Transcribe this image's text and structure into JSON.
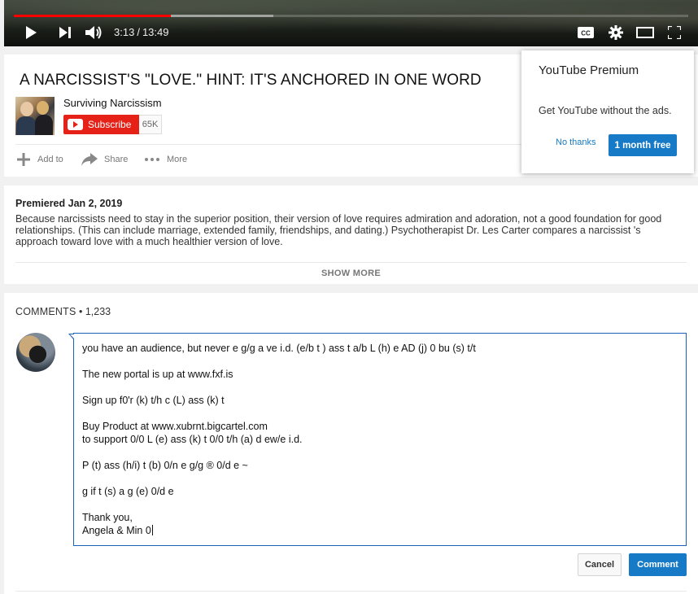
{
  "player": {
    "current_time": "3:13",
    "separator": "/",
    "duration": "13:49",
    "played_fraction": 0.233,
    "buffered_fraction": 0.385,
    "progress_color": "#ff0000"
  },
  "video": {
    "title": "A NARCISSIST'S \"LOVE.\" HINT: IT'S ANCHORED IN ONE WORD",
    "channel_name": "Surviving Narcissism",
    "subscribe_label": "Subscribe",
    "subscriber_count": "65K",
    "actions": [
      {
        "label": "Add to",
        "icon": "plus-icon"
      },
      {
        "label": "Share",
        "icon": "share-arrow-icon"
      },
      {
        "label": "More",
        "icon": "more-dots-icon"
      }
    ]
  },
  "premium_popup": {
    "title": "YouTube Premium",
    "text": "Get YouTube without the ads.",
    "no_thanks_label": "No thanks",
    "trial_label": "1 month free",
    "accent": "#167ac6"
  },
  "description": {
    "premiered": "Premiered Jan 2, 2019",
    "text": "Because narcissists need to stay in the superior position, their version of love requires admiration and adoration, not a good foundation for good relationships. (This can include marriage, extended family, friendships, and dating.) Psychotherapist Dr. Les Carter compares a narcissist 's approach toward love with a much healthier version of love.",
    "show_more_label": "SHOW MORE"
  },
  "comments": {
    "label": "COMMENTS",
    "bullet": " • ",
    "count": "1,233",
    "draft_lines": [
      "you have an audience, but never e g/g a ve i.d.  (e/b t ) ass t a/b L (h) e AD (j) 0 bu (s) t/t",
      "",
      "The new portal is up at www.fxf.is",
      "",
      "Sign up f0'r (k) t/h c (L) ass (k) t",
      "",
      "Buy Product at www.xubrnt.bigcartel.com",
      "to support 0/0 L (e) ass (k) t 0/0 t/h (a) d ew/e i.d.",
      "",
      "P (t) ass (h/i) t (b) 0/n e g/g ® 0/d e ~",
      "",
      "g if t (s) a g (e) 0/d e",
      "",
      "Thank you,",
      "Angela & Min 0"
    ],
    "cancel_label": "Cancel",
    "submit_label": "Comment"
  }
}
